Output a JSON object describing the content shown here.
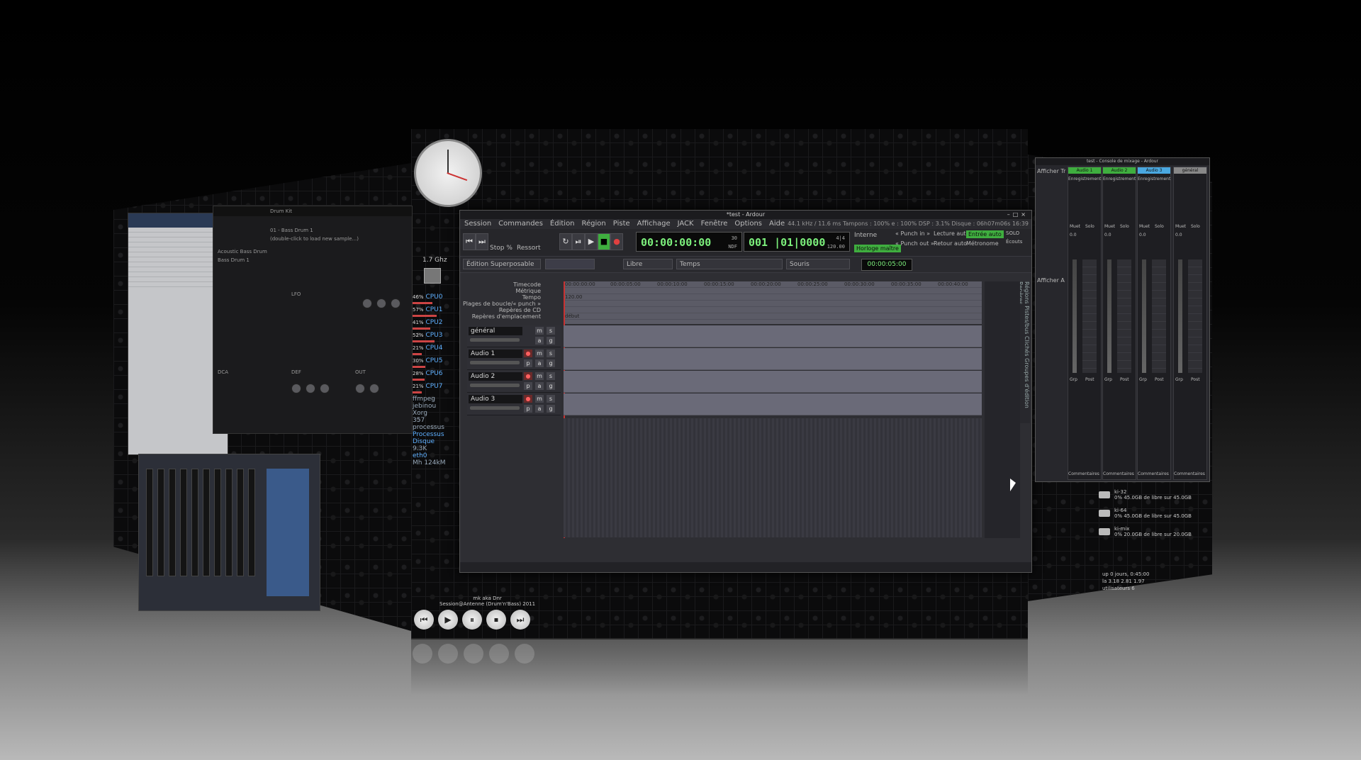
{
  "ardour": {
    "title": "*test - Ardour",
    "menu": [
      "Session",
      "Commandes",
      "Édition",
      "Région",
      "Piste",
      "Affichage",
      "JACK",
      "Fenêtre",
      "Options",
      "Aide"
    ],
    "status": "44.1 kHz / 11.6 ms   Tampons : 100% e : 100%   DSP : 3.1%   Disque : 06h07m06s 16:39",
    "stop_label": "Stop %",
    "ressort_label": "Ressort",
    "clock_primary": "00:00:00:00",
    "clock_primary_sub1": "30",
    "clock_primary_sub2": "NDF",
    "clock_secondary": "001 |01|0000",
    "clock_secondary_sub1": "4|4",
    "clock_secondary_sub2": "120.00",
    "interne": "Interne",
    "horloge": "Horloge maître",
    "punch_in": "« Punch in »",
    "punch_out": "« Punch out »",
    "lecture_auto": "Lecture auto",
    "retour_auto": "Retour auto",
    "entree_auto": "Entrée auto",
    "metronome": "Métronome",
    "solo": "SOLO",
    "ecouts": "Écouts",
    "edit_mode": "Édition Superposable",
    "snap_mode": "Libre",
    "grid": "Temps",
    "edit_point": "Souris",
    "nudge": "00:00:05:00",
    "rulers": [
      "Timecode",
      "Métrique",
      "Tempo",
      "Plages de boucle/« punch »",
      "Repères de CD",
      "Repères d'emplacement"
    ],
    "timecodes": [
      "00:00:00:00",
      "00:00:05:00",
      "00:00:10:00",
      "00:00:15:00",
      "00:00:20:00",
      "00:00:25:00",
      "00:00:30:00",
      "00:00:35:00",
      "00:00:40:00"
    ],
    "tempo_marker": "120.00",
    "start_marker": "début",
    "tracks": [
      {
        "name": "général",
        "rec": false
      },
      {
        "name": "Audio 1",
        "rec": true
      },
      {
        "name": "Audio 2",
        "rec": true
      },
      {
        "name": "Audio 3",
        "rec": true
      }
    ],
    "btn_m": "m",
    "btn_s": "s",
    "btn_p": "p",
    "btn_a": "a",
    "btn_g": "g",
    "side_tabs": "Régions   Pistes/bus   Clichés   Groupes d'édition   Repères"
  },
  "mixer": {
    "title": "test - Console de mixage - Ardour",
    "afficher": "Afficher Tr",
    "afficher2": "Afficher A",
    "strips": [
      {
        "name": "Audio 1",
        "color": "#3fae3f"
      },
      {
        "name": "Audio 2",
        "color": "#3fae3f"
      },
      {
        "name": "Audio 3",
        "color": "#4aa8e0"
      },
      {
        "name": "général",
        "color": "#888888"
      }
    ],
    "enregistrement": "Enregistrement",
    "muet": "Muet",
    "solo": "Solo",
    "gain": "0.0",
    "grp": "Grp",
    "post": "Post",
    "commentaires": "Commentaires"
  },
  "conky": {
    "cpu_freq": "1.7 Ghz",
    "cpus": [
      {
        "pct": "46%",
        "label": "CPU0"
      },
      {
        "pct": "57%",
        "label": "CPU1"
      },
      {
        "pct": "41%",
        "label": "CPU2"
      },
      {
        "pct": "52%",
        "label": "CPU3"
      },
      {
        "pct": "21%",
        "label": "CPU4"
      },
      {
        "pct": "30%",
        "label": "CPU5"
      },
      {
        "pct": "28%",
        "label": "CPU6"
      },
      {
        "pct": "21%",
        "label": "CPU7"
      }
    ],
    "procs": [
      "ffmpeg",
      "jebinou",
      "Xorg"
    ],
    "processus": "357 processus",
    "processus_label": "Processus",
    "disque": "Disque",
    "disque_val": "9.3K",
    "net": "eth0",
    "net_val": "Mh 124kM"
  },
  "drum": {
    "title": "Drum Kit",
    "sample": "01 - Bass Drum 1",
    "hint": "(double-click to load new sample...)",
    "items": [
      "Acoustic Bass Drum",
      "Bass Drum 1"
    ],
    "sections": [
      "LFO",
      "DCA",
      "DEF",
      "OUT"
    ]
  },
  "media": {
    "now_playing": "mk aka Dnr",
    "track": "Session@Antenne (Drum'n'Bass) 2011",
    "buttons": [
      "⏮",
      "▶",
      "⏸",
      "⏹",
      "⏭"
    ]
  },
  "drives": [
    {
      "name": "ki-32",
      "line": "45.0GB de libre sur 45.0GB",
      "pct": "0%"
    },
    {
      "name": "ki-64",
      "line": "45.0GB de libre sur 45.0GB",
      "pct": "0%"
    },
    {
      "name": "ki-mix",
      "line": "20.0GB de libre sur 20.0GB",
      "pct": "0%"
    }
  ],
  "sysinfo": [
    "up 0 jours, 0:45:00",
    "la 3.18 2.81 1.97",
    "utilisateurs 6"
  ]
}
